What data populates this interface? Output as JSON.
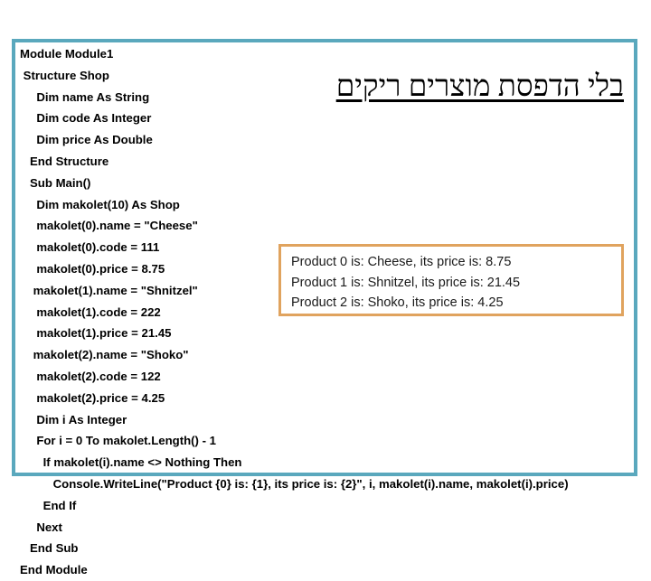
{
  "slide": {
    "frame_color": "#5aa8bd",
    "background": "#ffffff"
  },
  "heading": {
    "text": "בלי הדפסת מוצרים ריקים",
    "language": "hebrew",
    "underlined": true,
    "color": "#000000"
  },
  "code": {
    "language": "VB.NET",
    "lines": [
      "Module Module1",
      " Structure Shop",
      "     Dim name As String",
      "     Dim code As Integer",
      "     Dim price As Double",
      "   End Structure",
      "   Sub Main()",
      "     Dim makolet(10) As Shop",
      "     makolet(0).name = \"Cheese\"",
      "     makolet(0).code = 111",
      "     makolet(0).price = 8.75",
      "    makolet(1).name = \"Shnitzel\"",
      "     makolet(1).code = 222",
      "     makolet(1).price = 21.45",
      "    makolet(2).name = \"Shoko\"",
      "     makolet(2).code = 122",
      "     makolet(2).price = 4.25",
      "     Dim i As Integer",
      "     For i = 0 To makolet.Length() - 1",
      "       If makolet(i).name <> Nothing Then",
      "          Console.WriteLine(\"Product {0} is: {1}, its price is: {2}\", i, makolet(i).name, makolet(i).price)",
      "       End If",
      "     Next",
      "   End Sub",
      "End Module"
    ]
  },
  "output": {
    "border_color": "#e0a35e",
    "lines": [
      "Product 0 is: Cheese, its price is: 8.75",
      "Product 1 is: Shnitzel, its price is: 21.45",
      "Product 2 is: Shoko, its price is: 4.25"
    ]
  }
}
